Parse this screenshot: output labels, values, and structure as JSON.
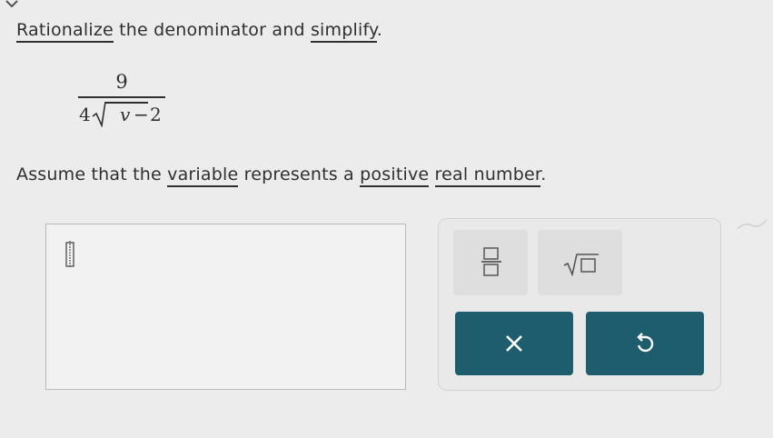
{
  "instruction": {
    "term1": "Rationalize",
    "middle": " the denominator and ",
    "term2": "simplify",
    "end": "."
  },
  "expression": {
    "numerator": "9",
    "coefficient": "4",
    "radicand": "v",
    "operator": "−",
    "constant": "2"
  },
  "assumption": {
    "start": "Assume that the ",
    "term1": "variable",
    "mid1": " represents a ",
    "term2": "positive",
    "space": " ",
    "term3": "real number",
    "end": "."
  },
  "answer": {
    "value": ""
  },
  "keypad": {
    "keys": [
      "fraction-icon",
      "square-root-icon"
    ],
    "actions": [
      "clear-icon",
      "undo-icon"
    ],
    "action_color": "#1e5d6e"
  }
}
